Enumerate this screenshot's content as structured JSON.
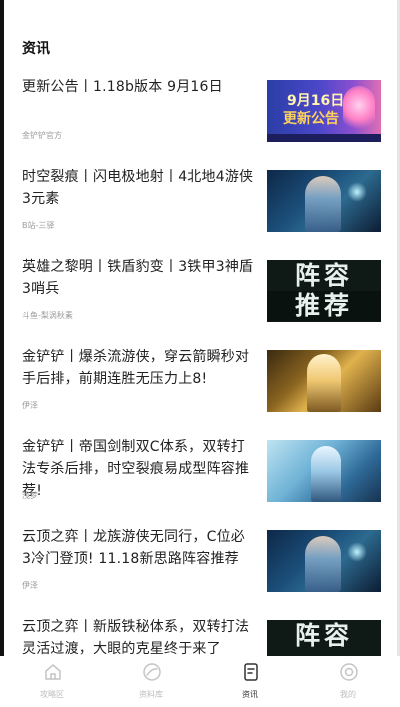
{
  "header": {
    "title": "资讯"
  },
  "articles": [
    {
      "title": "更新公告丨1.18b版本 9月16日",
      "source": "金铲铲官方",
      "thumb": {
        "type": "banner",
        "line1": "9月16日",
        "line2": "更新公告"
      }
    },
    {
      "title": "时空裂痕丨闪电极地射丨4北地4游侠3元素",
      "source": "B站-三驿",
      "thumb": {
        "type": "art"
      }
    },
    {
      "title": "英雄之黎明丨铁盾豹变丨3铁甲3神盾3哨兵",
      "source": "斗鱼-梨涡秋素",
      "thumb": {
        "type": "text",
        "line1": "阵容",
        "line2": "推荐"
      }
    },
    {
      "title": "金铲铲丨爆杀流游侠，穿云箭瞬秒对手后排，前期连胜无压力上8!",
      "source": "伊泽",
      "thumb": {
        "type": "gold"
      }
    },
    {
      "title": "金铲铲丨帝国剑制双C体系，双转打法专杀后排，时空裂痕易成型阵容推荐!",
      "source": "浅梦",
      "thumb": {
        "type": "blue"
      }
    },
    {
      "title": "云顶之弈丨龙族游侠无同行，C位必3冷门登顶! 11.18新思路阵容推荐",
      "source": "伊泽",
      "thumb": {
        "type": "art"
      }
    },
    {
      "title": "云顶之弈丨新版铁秘体系，双转打法灵活过渡，大眼的克星终于来了",
      "source": "",
      "thumb": {
        "type": "text",
        "line1": "阵容",
        "line2": ""
      }
    }
  ],
  "tabs": [
    {
      "label": "攻略区",
      "icon": "home-icon"
    },
    {
      "label": "资料库",
      "icon": "database-icon"
    },
    {
      "label": "资讯",
      "icon": "news-icon",
      "active": true
    },
    {
      "label": "我的",
      "icon": "profile-icon"
    }
  ]
}
